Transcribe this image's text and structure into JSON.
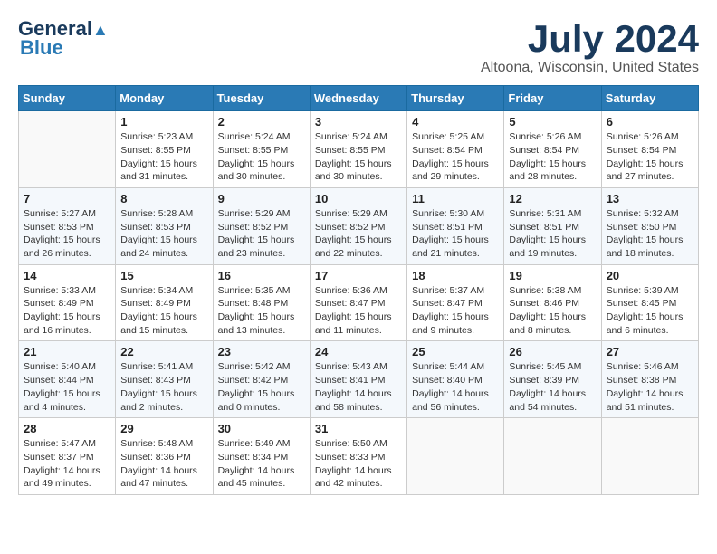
{
  "logo": {
    "line1": "General",
    "line2": "Blue"
  },
  "title": "July 2024",
  "location": "Altoona, Wisconsin, United States",
  "days_header": [
    "Sunday",
    "Monday",
    "Tuesday",
    "Wednesday",
    "Thursday",
    "Friday",
    "Saturday"
  ],
  "weeks": [
    [
      {
        "day": "",
        "info": ""
      },
      {
        "day": "1",
        "info": "Sunrise: 5:23 AM\nSunset: 8:55 PM\nDaylight: 15 hours\nand 31 minutes."
      },
      {
        "day": "2",
        "info": "Sunrise: 5:24 AM\nSunset: 8:55 PM\nDaylight: 15 hours\nand 30 minutes."
      },
      {
        "day": "3",
        "info": "Sunrise: 5:24 AM\nSunset: 8:55 PM\nDaylight: 15 hours\nand 30 minutes."
      },
      {
        "day": "4",
        "info": "Sunrise: 5:25 AM\nSunset: 8:54 PM\nDaylight: 15 hours\nand 29 minutes."
      },
      {
        "day": "5",
        "info": "Sunrise: 5:26 AM\nSunset: 8:54 PM\nDaylight: 15 hours\nand 28 minutes."
      },
      {
        "day": "6",
        "info": "Sunrise: 5:26 AM\nSunset: 8:54 PM\nDaylight: 15 hours\nand 27 minutes."
      }
    ],
    [
      {
        "day": "7",
        "info": "Sunrise: 5:27 AM\nSunset: 8:53 PM\nDaylight: 15 hours\nand 26 minutes."
      },
      {
        "day": "8",
        "info": "Sunrise: 5:28 AM\nSunset: 8:53 PM\nDaylight: 15 hours\nand 24 minutes."
      },
      {
        "day": "9",
        "info": "Sunrise: 5:29 AM\nSunset: 8:52 PM\nDaylight: 15 hours\nand 23 minutes."
      },
      {
        "day": "10",
        "info": "Sunrise: 5:29 AM\nSunset: 8:52 PM\nDaylight: 15 hours\nand 22 minutes."
      },
      {
        "day": "11",
        "info": "Sunrise: 5:30 AM\nSunset: 8:51 PM\nDaylight: 15 hours\nand 21 minutes."
      },
      {
        "day": "12",
        "info": "Sunrise: 5:31 AM\nSunset: 8:51 PM\nDaylight: 15 hours\nand 19 minutes."
      },
      {
        "day": "13",
        "info": "Sunrise: 5:32 AM\nSunset: 8:50 PM\nDaylight: 15 hours\nand 18 minutes."
      }
    ],
    [
      {
        "day": "14",
        "info": "Sunrise: 5:33 AM\nSunset: 8:49 PM\nDaylight: 15 hours\nand 16 minutes."
      },
      {
        "day": "15",
        "info": "Sunrise: 5:34 AM\nSunset: 8:49 PM\nDaylight: 15 hours\nand 15 minutes."
      },
      {
        "day": "16",
        "info": "Sunrise: 5:35 AM\nSunset: 8:48 PM\nDaylight: 15 hours\nand 13 minutes."
      },
      {
        "day": "17",
        "info": "Sunrise: 5:36 AM\nSunset: 8:47 PM\nDaylight: 15 hours\nand 11 minutes."
      },
      {
        "day": "18",
        "info": "Sunrise: 5:37 AM\nSunset: 8:47 PM\nDaylight: 15 hours\nand 9 minutes."
      },
      {
        "day": "19",
        "info": "Sunrise: 5:38 AM\nSunset: 8:46 PM\nDaylight: 15 hours\nand 8 minutes."
      },
      {
        "day": "20",
        "info": "Sunrise: 5:39 AM\nSunset: 8:45 PM\nDaylight: 15 hours\nand 6 minutes."
      }
    ],
    [
      {
        "day": "21",
        "info": "Sunrise: 5:40 AM\nSunset: 8:44 PM\nDaylight: 15 hours\nand 4 minutes."
      },
      {
        "day": "22",
        "info": "Sunrise: 5:41 AM\nSunset: 8:43 PM\nDaylight: 15 hours\nand 2 minutes."
      },
      {
        "day": "23",
        "info": "Sunrise: 5:42 AM\nSunset: 8:42 PM\nDaylight: 15 hours\nand 0 minutes."
      },
      {
        "day": "24",
        "info": "Sunrise: 5:43 AM\nSunset: 8:41 PM\nDaylight: 14 hours\nand 58 minutes."
      },
      {
        "day": "25",
        "info": "Sunrise: 5:44 AM\nSunset: 8:40 PM\nDaylight: 14 hours\nand 56 minutes."
      },
      {
        "day": "26",
        "info": "Sunrise: 5:45 AM\nSunset: 8:39 PM\nDaylight: 14 hours\nand 54 minutes."
      },
      {
        "day": "27",
        "info": "Sunrise: 5:46 AM\nSunset: 8:38 PM\nDaylight: 14 hours\nand 51 minutes."
      }
    ],
    [
      {
        "day": "28",
        "info": "Sunrise: 5:47 AM\nSunset: 8:37 PM\nDaylight: 14 hours\nand 49 minutes."
      },
      {
        "day": "29",
        "info": "Sunrise: 5:48 AM\nSunset: 8:36 PM\nDaylight: 14 hours\nand 47 minutes."
      },
      {
        "day": "30",
        "info": "Sunrise: 5:49 AM\nSunset: 8:34 PM\nDaylight: 14 hours\nand 45 minutes."
      },
      {
        "day": "31",
        "info": "Sunrise: 5:50 AM\nSunset: 8:33 PM\nDaylight: 14 hours\nand 42 minutes."
      },
      {
        "day": "",
        "info": ""
      },
      {
        "day": "",
        "info": ""
      },
      {
        "day": "",
        "info": ""
      }
    ]
  ]
}
